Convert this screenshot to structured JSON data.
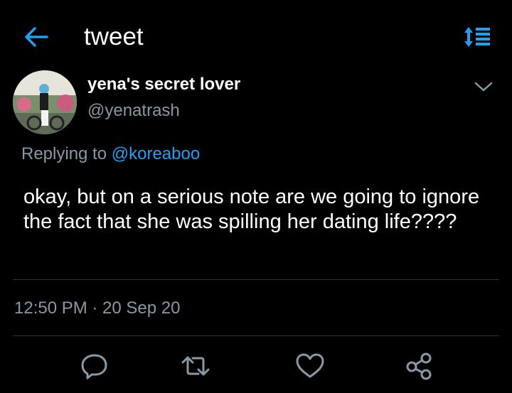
{
  "header": {
    "title": "tweet",
    "back_icon": "arrow-left-icon",
    "sort_icon": "sort-icon"
  },
  "colors": {
    "accent": "#1da1f2",
    "secondary_text": "#8899a6",
    "background": "#000000"
  },
  "tweet": {
    "display_name": "yena's secret lover",
    "handle": "@yenatrash",
    "replying_prefix": "Replying to ",
    "replying_to": "@koreaboo",
    "text": "okay, but on a serious note are we going to ignore the fact that she was spilling her dating life????",
    "timestamp": "12:50 PM · 20 Sep 20"
  },
  "actions": [
    {
      "icon": "reply-icon"
    },
    {
      "icon": "retweet-icon"
    },
    {
      "icon": "like-icon"
    },
    {
      "icon": "share-icon"
    }
  ]
}
